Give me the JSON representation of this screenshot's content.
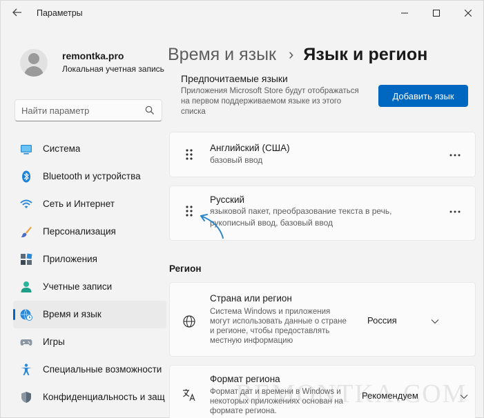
{
  "window": {
    "title": "Параметры",
    "controls": [
      "minimize",
      "maximize",
      "close"
    ]
  },
  "user": {
    "name": "remontka.pro",
    "account_type": "Локальная учетная запись"
  },
  "search": {
    "placeholder": "Найти параметр"
  },
  "sidebar": {
    "items": [
      {
        "label": "Система",
        "icon": "system-icon"
      },
      {
        "label": "Bluetooth и устройства",
        "icon": "bluetooth-icon"
      },
      {
        "label": "Сеть и Интернет",
        "icon": "wifi-icon"
      },
      {
        "label": "Персонализация",
        "icon": "brush-icon"
      },
      {
        "label": "Приложения",
        "icon": "apps-icon"
      },
      {
        "label": "Учетные записи",
        "icon": "account-icon"
      },
      {
        "label": "Время и язык",
        "icon": "time-language-icon",
        "active": true
      },
      {
        "label": "Игры",
        "icon": "gamepad-icon"
      },
      {
        "label": "Специальные возможности",
        "icon": "accessibility-icon"
      },
      {
        "label": "Конфиденциальность и защ",
        "icon": "shield-icon"
      }
    ]
  },
  "breadcrumb": {
    "parent": "Время и язык",
    "separator": "›",
    "current": "Язык и регион"
  },
  "preferred_languages": {
    "title": "Предпочитаемые языки",
    "description": "Приложения Microsoft Store будут отображаться на первом поддерживаемом языке из этого списка",
    "add_button": "Добавить язык",
    "languages": [
      {
        "name": "Английский (США)",
        "features": "базовый ввод"
      },
      {
        "name": "Русский",
        "features": "языковой пакет, преобразование текста в речь, рукописный ввод, базовый ввод"
      }
    ]
  },
  "region": {
    "header": "Регион",
    "country": {
      "title": "Страна или регион",
      "description": "Система Windows и приложения могут использовать данные о стране и регионе, чтобы предоставлять местную информацию",
      "value": "Россия"
    },
    "format": {
      "title": "Формат региона",
      "description": "Формат дат и времени в Windows и некоторых приложениях основан на формате региона.",
      "value": "Рекомендуем"
    }
  },
  "watermark": "REMONTKA.COM",
  "colors": {
    "accent": "#0067c0",
    "background": "#f3f3f3",
    "card": "#fbfbfb",
    "annotation_arrow": "#2b86c8"
  }
}
